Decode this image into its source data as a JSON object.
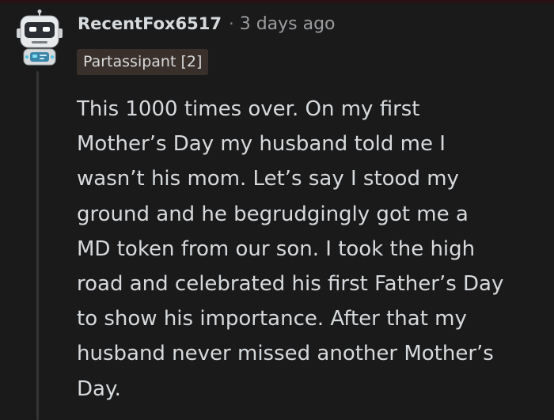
{
  "comment": {
    "author": "RecentFox6517",
    "separator": "·",
    "timestamp": "3 days ago",
    "flair": "Partassipant [2]",
    "avatar_icon": "robot-avatar-icon",
    "lines": [
      "This 1000 times over. On my first",
      "Mother’s Day my husband told me I",
      "wasn’t his mom. Let’s say I stood my",
      "ground and he begrudgingly got me a",
      "MD token from our son. I took the high",
      "road and celebrated his first Father’s Day",
      "to show his importance. After that my",
      "husband never missed another Mother’s",
      "Day."
    ]
  },
  "colors": {
    "background": "#1a1a1b",
    "text": "#d7dadc",
    "muted": "#9a9c9e",
    "flair_bg": "#3a302b",
    "thread_line": "#343536",
    "avatar_accent": "#4ec3e0"
  }
}
